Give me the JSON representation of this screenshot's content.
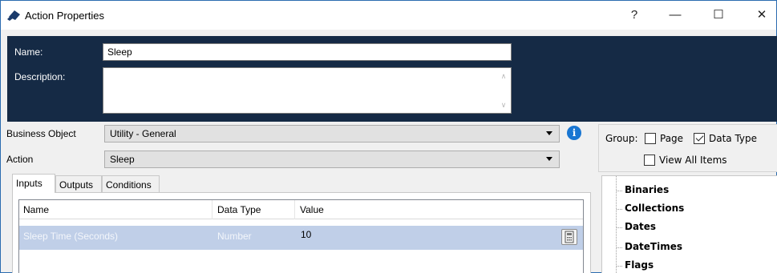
{
  "window": {
    "title": "Action Properties",
    "controls": {
      "help": "?",
      "minimize": "—",
      "maximize": "☐",
      "close": "✕"
    }
  },
  "header": {
    "name_label": "Name:",
    "name_value": "Sleep",
    "description_label": "Description:",
    "description_value": ""
  },
  "form": {
    "business_object_label": "Business Object",
    "business_object_value": "Utility - General",
    "action_label": "Action",
    "action_value": "Sleep"
  },
  "tabs": [
    {
      "label": "Inputs",
      "active": true
    },
    {
      "label": "Outputs",
      "active": false
    },
    {
      "label": "Conditions",
      "active": false
    }
  ],
  "grid": {
    "columns": [
      "Name",
      "Data Type",
      "Value"
    ],
    "rows": [
      {
        "name": "Sleep Time (Seconds)",
        "data_type": "Number",
        "value": "10"
      }
    ]
  },
  "group": {
    "label": "Group:",
    "page_label": "Page",
    "page_checked": false,
    "data_type_label": "Data Type",
    "data_type_checked": true,
    "view_all_label": "View All Items",
    "view_all_checked": false
  },
  "tree": {
    "items": [
      "Binaries",
      "Collections",
      "Dates",
      "DateTimes",
      "Flags"
    ]
  },
  "colors": {
    "header_bg": "#152a45",
    "selected_row": "#c0cfe8",
    "info_icon": "#1976d2"
  }
}
